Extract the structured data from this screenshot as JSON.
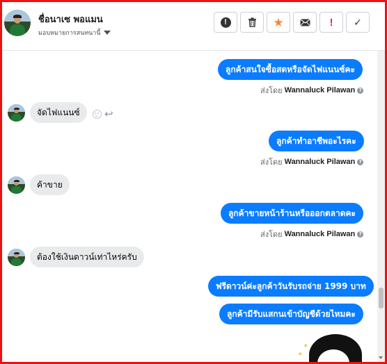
{
  "header": {
    "contact_name": "ชื่อนาเซ พอแมน",
    "subtitle": "มอบหมายการสนทนานี้",
    "buttons": [
      {
        "name": "report-button",
        "icon": "exclamation-circle-icon"
      },
      {
        "name": "delete-button",
        "icon": "trash-icon"
      },
      {
        "name": "star-button",
        "icon": "star-icon"
      },
      {
        "name": "mark-unread-button",
        "icon": "envelope-icon"
      },
      {
        "name": "priority-button",
        "icon": "exclamation-icon"
      },
      {
        "name": "done-button",
        "icon": "check-icon"
      }
    ],
    "star_color": "#f0883e",
    "priority_color": "#e0245e"
  },
  "messages": [
    {
      "direction": "out",
      "text": "ลูกค้าสนใจซื้อสดหรือจัดไฟแนนซ์คะ"
    },
    {
      "direction": "out_meta",
      "sent_by_label": "ส่งโดย",
      "sender": "Wannaluck Pilawan"
    },
    {
      "direction": "in",
      "text": "จัดไฟแนนซ์"
    },
    {
      "direction": "out",
      "text": "ลูกค้าทำอาชีพอะไรคะ"
    },
    {
      "direction": "out_meta",
      "sent_by_label": "ส่งโดย",
      "sender": "Wannaluck Pilawan"
    },
    {
      "direction": "in",
      "text": "ค้าขาย"
    },
    {
      "direction": "out",
      "text": "ลูกค้าขายหน้าร้านหรือออกตลาดคะ"
    },
    {
      "direction": "out_meta",
      "sent_by_label": "ส่งโดย",
      "sender": "Wannaluck Pilawan"
    },
    {
      "direction": "in",
      "text": "ต้องใช้เงินดาวน์เท่าไหร่ครับ"
    },
    {
      "direction": "out",
      "text": "ฟรีดาวน์ค่ะลูกค้าวันรับรถจ่าย 1999 บาท"
    },
    {
      "direction": "out",
      "text": "ลูกค้ามีรับแสกนเข้าบัญชีด้วยไหมคะ"
    }
  ],
  "theme": {
    "outgoing_bubble": "#0a7cff",
    "incoming_bubble": "#e9eaec",
    "frame_border": "#ee1111"
  }
}
